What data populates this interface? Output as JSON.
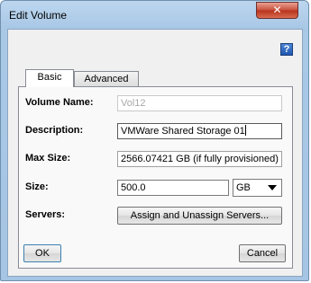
{
  "window": {
    "title": "Edit Volume"
  },
  "tabs": [
    {
      "label": "Basic",
      "selected": true
    },
    {
      "label": "Advanced",
      "selected": false
    }
  ],
  "form": {
    "volume_name": {
      "label": "Volume Name:",
      "value": "Vol12",
      "enabled": false
    },
    "description": {
      "label": "Description:",
      "value": "VMWare Shared Storage 01"
    },
    "max_size": {
      "label": "Max Size:",
      "value": "2566.07421 GB (if fully provisioned)"
    },
    "size": {
      "label": "Size:",
      "value": "500.0",
      "unit": "GB"
    },
    "servers": {
      "label": "Servers:",
      "button_label": "Assign and Unassign Servers..."
    }
  },
  "footer": {
    "ok_label": "OK",
    "cancel_label": "Cancel"
  },
  "icons": {
    "close": "close-icon",
    "help": "help-icon",
    "dropdown": "chevron-down-icon"
  },
  "colors": {
    "titlebar": "#bcd6ee",
    "close_button": "#c8503b",
    "help": "#2f67c0"
  }
}
